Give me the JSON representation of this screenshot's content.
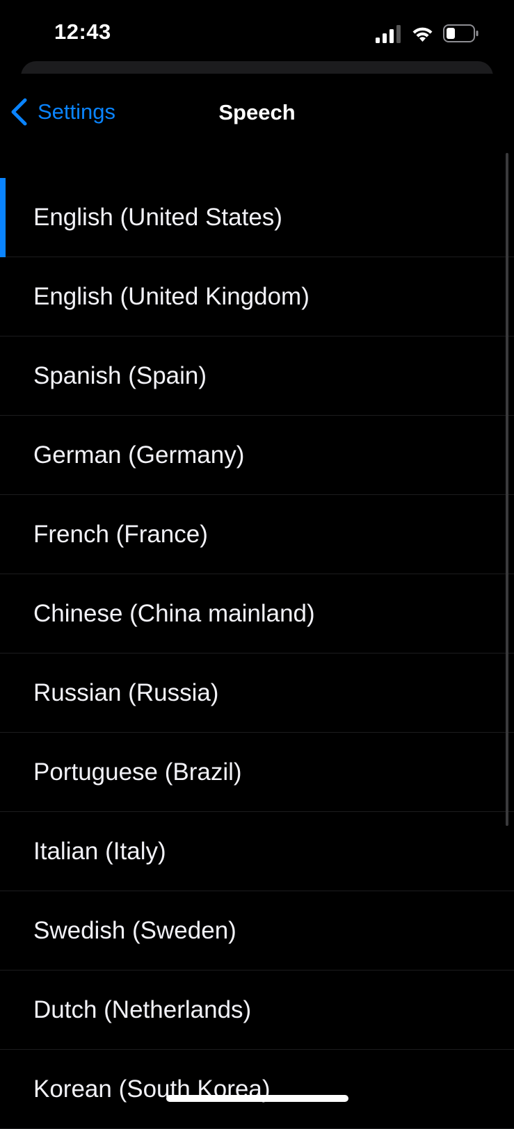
{
  "status_bar": {
    "time": "12:43",
    "icons": [
      "cellular-signal-icon",
      "wifi-icon",
      "battery-icon"
    ],
    "signal_bars_active": 3
  },
  "nav": {
    "back_label": "Settings",
    "title": "Speech"
  },
  "languages": [
    {
      "label": "English (United States)",
      "selected": true
    },
    {
      "label": "English (United Kingdom)",
      "selected": false
    },
    {
      "label": "Spanish (Spain)",
      "selected": false
    },
    {
      "label": "German (Germany)",
      "selected": false
    },
    {
      "label": "French (France)",
      "selected": false
    },
    {
      "label": "Chinese (China mainland)",
      "selected": false
    },
    {
      "label": "Russian (Russia)",
      "selected": false
    },
    {
      "label": "Portuguese (Brazil)",
      "selected": false
    },
    {
      "label": "Italian (Italy)",
      "selected": false
    },
    {
      "label": "Swedish (Sweden)",
      "selected": false
    },
    {
      "label": "Dutch (Netherlands)",
      "selected": false
    },
    {
      "label": "Korean (South Korea)",
      "selected": false
    }
  ],
  "colors": {
    "accent": "#0a84ff",
    "background": "#000000",
    "separator": "#1c1c1e",
    "text": "#f2f2f7"
  }
}
